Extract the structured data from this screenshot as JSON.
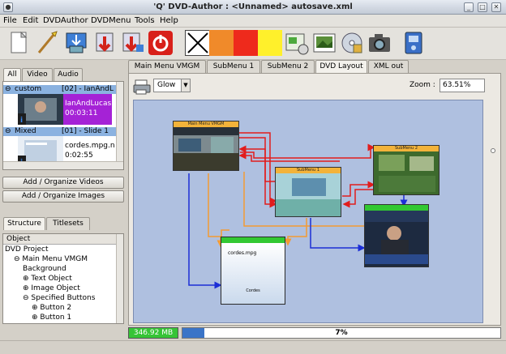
{
  "window": {
    "title": "'Q' DVD-Author : <Unnamed> autosave.xml"
  },
  "menu": [
    "File",
    "Edit",
    "DVDAuthor",
    "DVDMenu",
    "Tools",
    "Help"
  ],
  "toolbar": {
    "icons": [
      "new-project-icon",
      "open-project-icon",
      "import-menu-icon",
      "save-icon",
      "save-as-icon",
      "quit-icon",
      "no-color-icon",
      "orange-swatch",
      "red-swatch",
      "yellow-swatch",
      "add-menu-icon",
      "add-image-icon",
      "add-disc-icon",
      "add-camera-icon",
      "add-file-icon"
    ],
    "colors": {
      "orange": "#f08a2a",
      "red": "#ee2a1c",
      "yellow": "#fff02b"
    }
  },
  "media_tabs": [
    "All",
    "Video",
    "Audio"
  ],
  "media_list": {
    "groups": [
      {
        "name": "custom",
        "info": "[02] - IanAndL",
        "items": [
          {
            "name": "IanAndLucas",
            "time": "00:03:11",
            "bg": "#a522d6"
          }
        ]
      },
      {
        "name": "Mixed",
        "info": "[01] - Slide 1",
        "items": [
          {
            "name": "cordes.mpg.n",
            "time": "0:02:55",
            "bg": "#ffffff"
          }
        ]
      }
    ]
  },
  "buttons": {
    "add_videos": "Add / Organize Videos",
    "add_images": "Add / Organize Images"
  },
  "structure_tabs": [
    "Structure",
    "Titlesets"
  ],
  "tree": {
    "header": "Object",
    "rows": [
      {
        "text": "DVD Project",
        "indent": 0,
        "expander": ""
      },
      {
        "text": "Main Menu VMGM",
        "indent": 1,
        "expander": "⊖"
      },
      {
        "text": "Background",
        "indent": 2,
        "expander": ""
      },
      {
        "text": "Text Object",
        "indent": 2,
        "expander": "⊕"
      },
      {
        "text": "Image Object",
        "indent": 2,
        "expander": "⊕"
      },
      {
        "text": "Specified Buttons",
        "indent": 2,
        "expander": "⊖"
      },
      {
        "text": "Button 2",
        "indent": 3,
        "expander": "⊕"
      },
      {
        "text": "Button 1",
        "indent": 3,
        "expander": "⊕"
      }
    ]
  },
  "main_tabs": [
    {
      "label": "Main Menu VMGM",
      "active": false
    },
    {
      "label": "SubMenu 1",
      "active": false
    },
    {
      "label": "SubMenu 2",
      "active": false
    },
    {
      "label": "DVD Layout",
      "active": true
    },
    {
      "label": "XML out",
      "active": false
    }
  ],
  "layout_toolbar": {
    "style": "Glow",
    "zoom_label": "Zoom :",
    "zoom_value": "63.51%"
  },
  "nodes": [
    {
      "id": "main-menu-vmgm",
      "title": "Main Menu VMGM"
    },
    {
      "id": "submenu-1",
      "title": "SubMenu 1"
    },
    {
      "id": "submenu-2",
      "title": "SubMenu 2"
    },
    {
      "id": "video-news",
      "title": ""
    },
    {
      "id": "slide-cordes",
      "title": "cordes.mpg",
      "subtitle": "Cordes"
    }
  ],
  "status": {
    "size": "346.92 MB",
    "progress_label": "7%",
    "progress_fraction": 0.07
  }
}
